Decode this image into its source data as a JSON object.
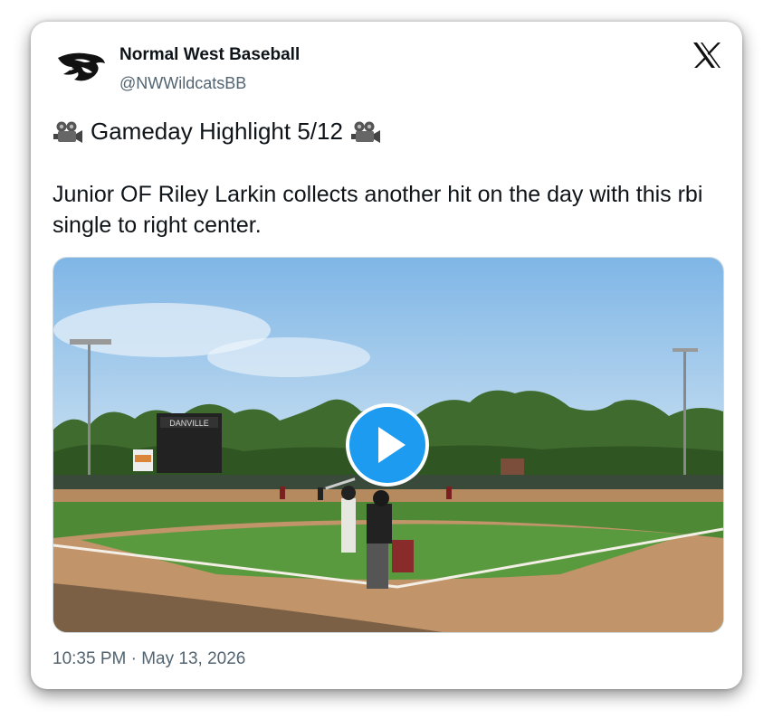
{
  "author": {
    "display_name": "Normal West Baseball",
    "handle": "@NWWildcatsBB",
    "logo_icon": "wildcat-logo-icon"
  },
  "platform_icon": "x-logo-icon",
  "post": {
    "headline": "Gameday Highlight 5/12",
    "headline_icon": "movie-camera-icon",
    "body": "Junior OF Riley Larkin collects another hit on the day with this rbi single to right center.",
    "timestamp": "10:35 PM · May 13, 2026"
  },
  "media": {
    "type": "video",
    "play_icon": "play-icon",
    "accent_color": "#1d9bf0",
    "scoreboard_text": "DANVILLE"
  }
}
